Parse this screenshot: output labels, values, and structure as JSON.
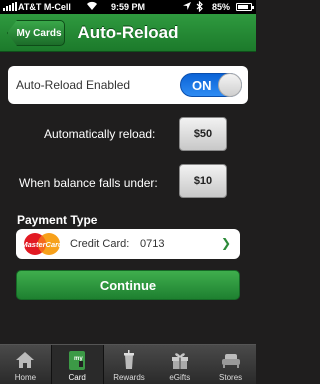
{
  "status_bar": {
    "carrier": "AT&T M-Cell",
    "time": "9:59 PM",
    "battery": "85%",
    "battery_level": 0.85
  },
  "header": {
    "back_label": "My Cards",
    "title": "Auto-Reload"
  },
  "auto_reload": {
    "label": "Auto-Reload Enabled",
    "toggle_text": "ON",
    "enabled": true,
    "toggle_color": "#1a73e8"
  },
  "reload_settings": {
    "reload_label": "Automatically reload:",
    "reload_amount": "$50",
    "threshold_label": "When balance falls under:",
    "threshold_amount": "$10"
  },
  "payment": {
    "title": "Payment Type",
    "logo_text": "MasterCard",
    "card_label": "Credit Card:",
    "card_number": "0713"
  },
  "continue_label": "Continue",
  "brand_color": "#2a8c3a",
  "tabs": [
    {
      "label": "Home",
      "icon": "home-icon"
    },
    {
      "label": "Card",
      "icon": "card-icon",
      "active": true
    },
    {
      "label": "Rewards",
      "icon": "cup-icon"
    },
    {
      "label": "eGifts",
      "icon": "gift-icon"
    },
    {
      "label": "Stores",
      "icon": "couch-icon"
    }
  ]
}
